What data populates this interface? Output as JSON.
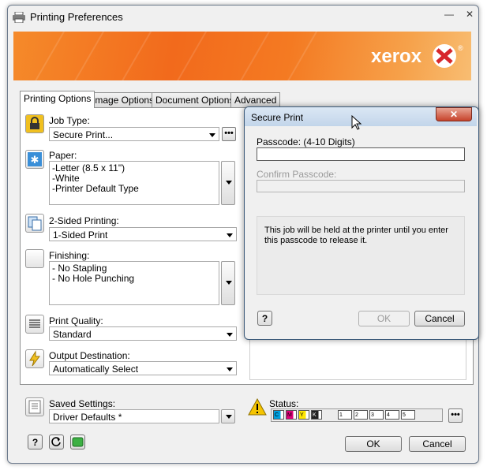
{
  "window": {
    "title": "Printing Preferences",
    "minimize_symbol": "—",
    "close_symbol": "✕"
  },
  "banner": {
    "brand": "xerox",
    "registered": "®",
    "colors": {
      "orange": "#f26a1c",
      "red": "#d7262c"
    }
  },
  "tabs": [
    {
      "label": "Printing Options",
      "active": true
    },
    {
      "label": "Image Options",
      "active": false
    },
    {
      "label": "Document Options",
      "active": false
    },
    {
      "label": "Advanced",
      "active": false
    }
  ],
  "job_type": {
    "label": "Job Type:",
    "value": "Secure Print...",
    "more": "•••"
  },
  "paper": {
    "label": "Paper:",
    "lines": [
      "-Letter (8.5 x 11\")",
      "-White",
      "-Printer Default Type"
    ]
  },
  "two_sided": {
    "label": "2-Sided Printing:",
    "value": "1-Sided Print"
  },
  "finishing": {
    "label": "Finishing:",
    "lines": [
      "- No Stapling",
      "- No Hole Punching"
    ]
  },
  "print_quality": {
    "label": "Print Quality:",
    "value": "Standard"
  },
  "output_destination": {
    "label": "Output Destination:",
    "value": "Automatically Select"
  },
  "saved_settings": {
    "label": "Saved Settings:",
    "value": "Driver Defaults *"
  },
  "status": {
    "label": "Status:",
    "toners": [
      {
        "letter": "C",
        "color": "#00a0e0"
      },
      {
        "letter": "M",
        "color": "#e0007a"
      },
      {
        "letter": "Y",
        "color": "#ffe600"
      },
      {
        "letter": "K",
        "color": "#222222"
      }
    ],
    "trays": [
      "1",
      "2",
      "3",
      "4",
      "5"
    ],
    "more": "•••"
  },
  "footer": {
    "help": "?",
    "ok": "OK",
    "cancel": "Cancel"
  },
  "dialog": {
    "title": "Secure Print",
    "close_symbol": "✕",
    "passcode_label": "Passcode: (4-10 Digits)",
    "passcode_value": "",
    "confirm_label": "Confirm Passcode:",
    "confirm_value": "",
    "message": "This job will be held at the printer until you enter this passcode to release it.",
    "help": "?",
    "ok": "OK",
    "cancel": "Cancel"
  }
}
